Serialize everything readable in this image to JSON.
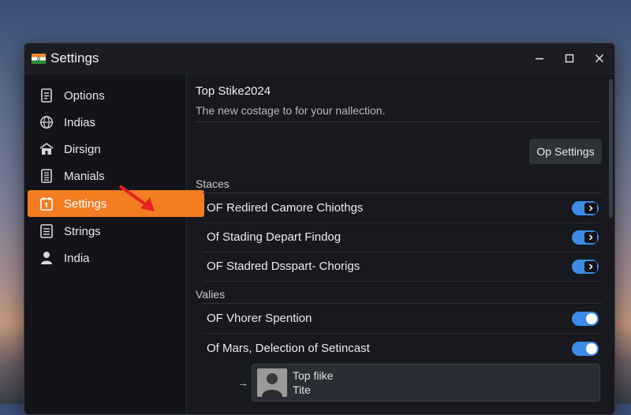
{
  "window": {
    "title": "Settings",
    "app_icon": "india-flag-icon"
  },
  "window_controls": [
    "minimize-icon",
    "maximize-icon",
    "close-icon"
  ],
  "sidebar": {
    "items": [
      {
        "label": "Options",
        "icon": "document-icon",
        "active": false
      },
      {
        "label": "Indias",
        "icon": "globe-icon",
        "active": false
      },
      {
        "label": "Dirsign",
        "icon": "home-icon",
        "active": false
      },
      {
        "label": "Manials",
        "icon": "book-icon",
        "active": false
      },
      {
        "label": "Settings",
        "icon": "calendar-icon",
        "active": true
      },
      {
        "label": "Strings",
        "icon": "list-icon",
        "active": false
      },
      {
        "label": "India",
        "icon": "user-icon",
        "active": false
      }
    ],
    "active_color": "#f27d22"
  },
  "main": {
    "title": "Top Stike2024",
    "subtitle": "The new costage to for your nallection.",
    "op_button": "Op Settings",
    "sections": [
      {
        "label": "Staces",
        "rows": [
          {
            "label": "OF Redired Camore Chiothgs",
            "toggle": "on-arrow"
          },
          {
            "label": "Of Stading Depart Findog",
            "toggle": "on-arrow"
          },
          {
            "label": "OF Stadred Dsspart- Chorigs",
            "toggle": "on-arrow"
          }
        ]
      },
      {
        "label": "Valies",
        "rows": [
          {
            "label": "OF Vhorer Spention",
            "toggle": "on"
          },
          {
            "label": "Of Mars, Delection of Setincast",
            "toggle": "on"
          }
        ]
      }
    ],
    "card": {
      "arrow": "→",
      "title": "Top fiike",
      "subtitle": "Tite"
    }
  },
  "colors": {
    "accent": "#f27d22",
    "toggle_on": "#3e8ae6",
    "window_bg": "#17191f"
  }
}
